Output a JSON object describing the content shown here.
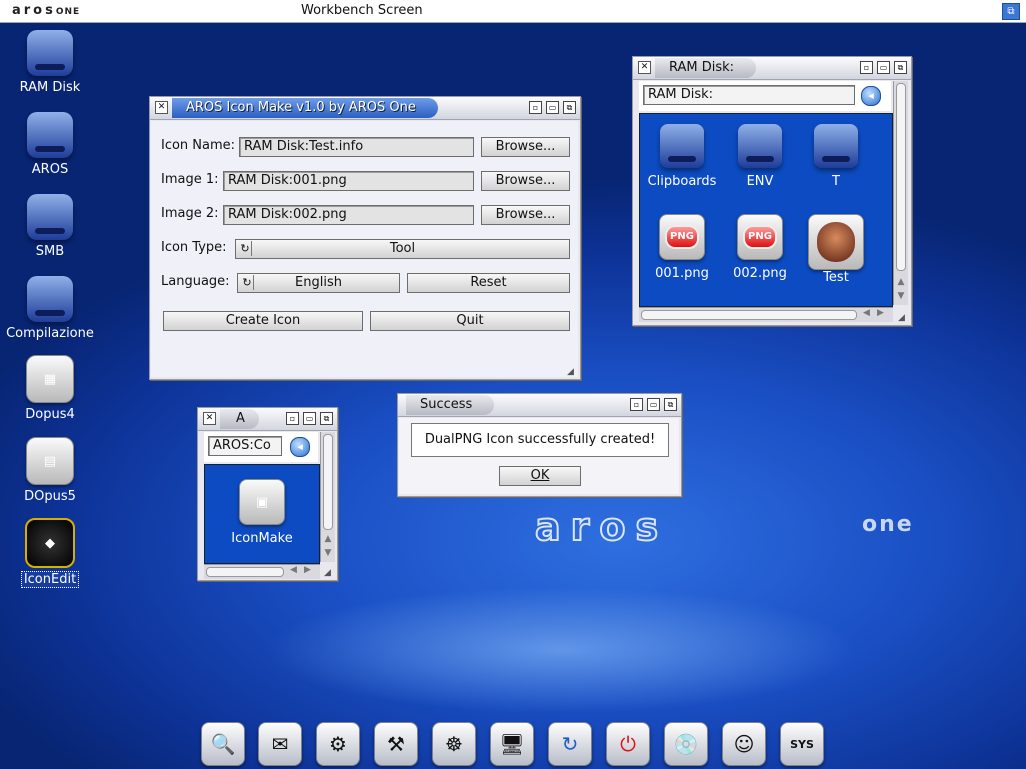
{
  "topbar": {
    "logo": "aros",
    "logo_suffix": "ONE",
    "screen_title": "Workbench Screen",
    "depth_icon": "depth-gadget-icon"
  },
  "desktop_icons": [
    {
      "label": "RAM Disk",
      "icon": "ram-disk-icon"
    },
    {
      "label": "AROS",
      "icon": "aros-drive-icon"
    },
    {
      "label": "SMB",
      "icon": "network-drive-icon"
    },
    {
      "label": "Compilazione",
      "icon": "drive-icon"
    },
    {
      "label": "Dopus4",
      "icon": "dopus-icon"
    },
    {
      "label": "DOpus5",
      "icon": "dopus-icon"
    },
    {
      "label": "IconEdit",
      "icon": "iconedit-icon"
    }
  ],
  "iconmake_window": {
    "title": "AROS Icon Make v1.0 by AROS One",
    "icon_name_label": "Icon Name:",
    "icon_name_value": "RAM Disk:Test.info",
    "image1_label": "Image 1:",
    "image1_value": "RAM Disk:001.png",
    "image2_label": "Image 2:",
    "image2_value": "RAM Disk:002.png",
    "browse_label": "Browse...",
    "icon_type_label": "Icon Type:",
    "icon_type_value": "Tool",
    "language_label": "Language:",
    "language_value": "English",
    "reset_label": "Reset",
    "create_label": "Create Icon",
    "quit_label": "Quit"
  },
  "ramdisk_window": {
    "title": "RAM Disk:",
    "path": "RAM Disk:",
    "items": [
      {
        "label": "Clipboards",
        "icon": "drawer-icon"
      },
      {
        "label": "ENV",
        "icon": "drawer-icon"
      },
      {
        "label": "T",
        "icon": "drawer-icon"
      },
      {
        "label": "001.png",
        "icon": "png-icon"
      },
      {
        "label": "002.png",
        "icon": "png-icon"
      },
      {
        "label": "Test",
        "icon": "demon-icon"
      }
    ]
  },
  "a_window": {
    "title": "A",
    "path": "AROS:Co",
    "items": [
      {
        "label": "IconMake",
        "icon": "iconmake-icon"
      }
    ]
  },
  "success_dialog": {
    "title": "Success",
    "message": "DualPNG Icon successfully created!",
    "ok_label": "OK"
  },
  "wallpaper": {
    "logo": "aros",
    "logo_suffix": "one"
  },
  "dock": [
    {
      "name": "search-icon",
      "glyph": "🔍"
    },
    {
      "name": "mail-icon",
      "glyph": "✉"
    },
    {
      "name": "settings-gear-icon",
      "glyph": "⚙"
    },
    {
      "name": "tools-icon",
      "glyph": "⚒"
    },
    {
      "name": "indian-chief-icon",
      "glyph": "☸"
    },
    {
      "name": "monitor-icon",
      "glyph": "🖥"
    },
    {
      "name": "refresh-icon",
      "glyph": "↻"
    },
    {
      "name": "power-icon",
      "glyph": "⏻"
    },
    {
      "name": "disk-icon",
      "glyph": "💿"
    },
    {
      "name": "einstein-icon",
      "glyph": "☺"
    },
    {
      "name": "sys-icon",
      "glyph": "SYS"
    }
  ]
}
